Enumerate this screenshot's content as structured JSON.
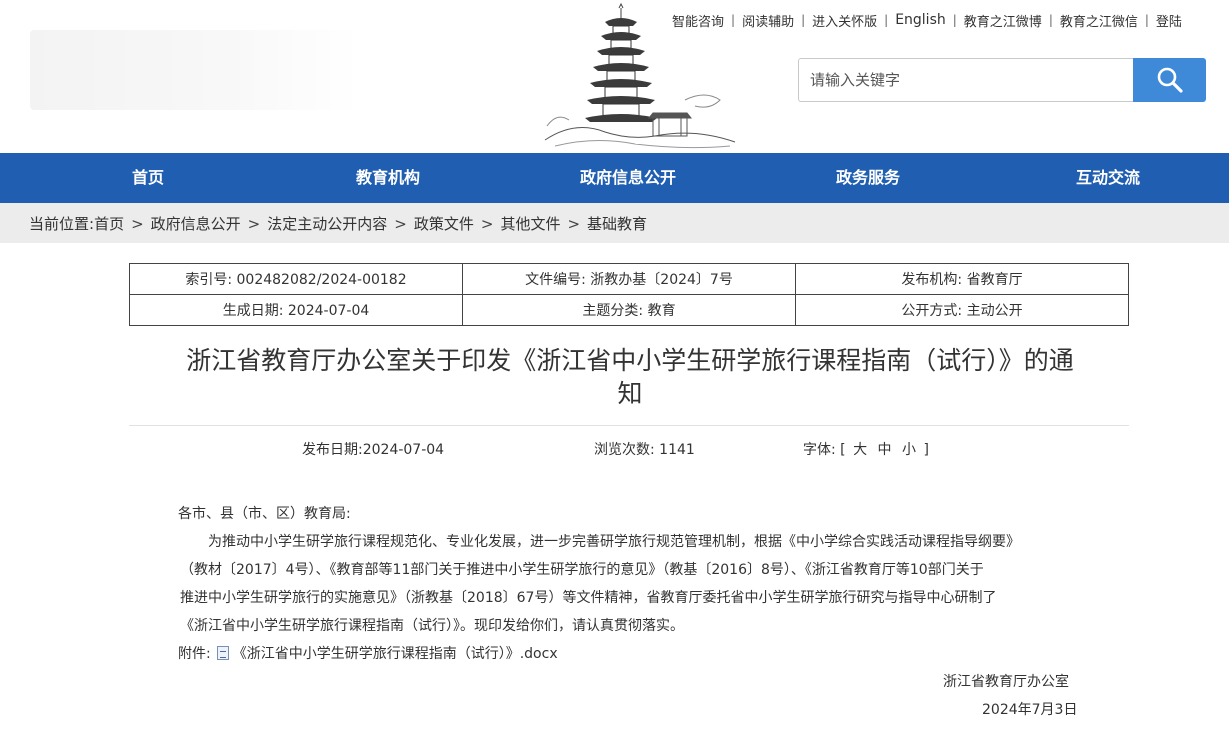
{
  "top_links": [
    "智能咨询",
    "阅读辅助",
    "进入关怀版",
    "English",
    "教育之江微博",
    "教育之江微信",
    "登陆"
  ],
  "search": {
    "placeholder": "请输入关键字",
    "button_icon": "search-icon"
  },
  "nav": [
    "首页",
    "教育机构",
    "政府信息公开",
    "政务服务",
    "互动交流"
  ],
  "breadcrumb": {
    "prefix": "当前位置:",
    "items": [
      "首页",
      "政府信息公开",
      "法定主动公开内容",
      "政策文件",
      "其他文件",
      "基础教育"
    ],
    "separator": ">"
  },
  "meta": {
    "index_no": "索引号: 002482082/2024-00182",
    "doc_no": "文件编号: 浙教办基〔2024〕7号",
    "issuer": "发布机构: 省教育厅",
    "created": "生成日期: 2024-07-04",
    "category": "主题分类: 教育",
    "open_mode": "公开方式: 主动公开"
  },
  "title_line1": "浙江省教育厅办公室关于印发《浙江省中小学生研学旅行课程指南（试行）》的通",
  "title_line2": "知",
  "info": {
    "publish_date": "发布日期:2024-07-04",
    "views": "浏览次数: 1141",
    "font_label": "字体:",
    "bracket_open": "[",
    "font_large": "大",
    "font_medium": "中",
    "font_small": "小",
    "bracket_close": "]"
  },
  "article": {
    "salutation": "各市、县（市、区）教育局:",
    "lines": [
      "为推动中小学生研学旅行课程规范化、专业化发展，进一步完善研学旅行规范管理机制，根据《中小学综合实践活动课程指导纲要》",
      "（教材〔2017〕4号）、《教育部等11部门关于推进中小学生研学旅行的意见》（教基〔2016〕8号）、《浙江省教育厅等10部门关于",
      "推进中小学生研学旅行的实施意见》（浙教基〔2018〕67号）等文件精神，省教育厅委托省中小学生研学旅行研究与指导中心研制了",
      "《浙江省中小学生研学旅行课程指南（试行）》。现印发给你们，请认真贯彻落实。"
    ],
    "attachment_label": "附件:",
    "attachment_name": "《浙江省中小学生研学旅行课程指南（试行）》.docx",
    "signature": "浙江省教育厅办公室",
    "date": "2024年7月3日"
  },
  "colors": {
    "nav_bg": "#1f5eb0",
    "search_btn": "#3f8ad8",
    "breadcrumb_bg": "#ececec"
  }
}
